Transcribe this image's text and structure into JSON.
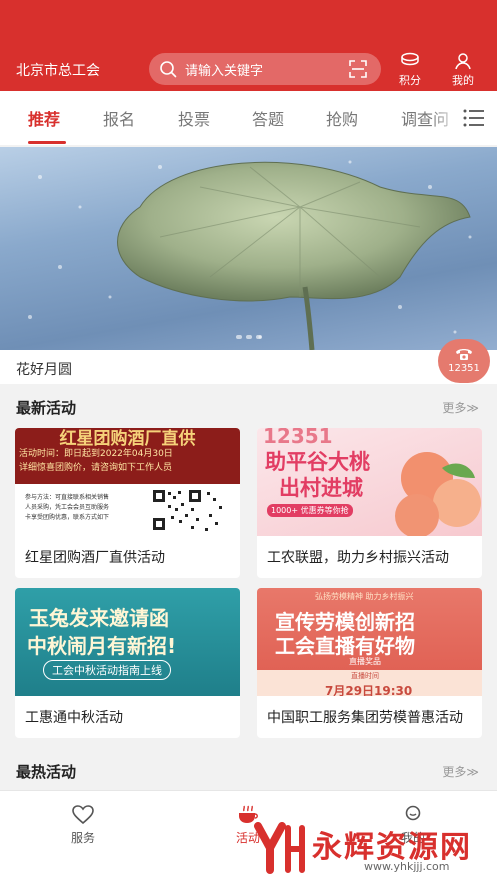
{
  "header": {
    "org_name": "北京市总工会",
    "search_placeholder": "请输入关键字",
    "points_label": "积分",
    "mine_label": "我的"
  },
  "tabs": [
    {
      "label": "推荐",
      "active": true
    },
    {
      "label": "报名"
    },
    {
      "label": "投票"
    },
    {
      "label": "答题"
    },
    {
      "label": "抢购"
    },
    {
      "label": "调查问"
    }
  ],
  "banner": {
    "caption": "花好月圆"
  },
  "hotline": {
    "number": "12351"
  },
  "latest": {
    "title": "最新活动",
    "more": "更多≫",
    "cards": [
      {
        "title": "红星团购酒厂直供活动",
        "img_lines": [
          "红星团购酒厂直供",
          "活动时间：即日起到2022年04月30日",
          "详细惊喜团购价，请咨询如下工作人员",
          "参与方法：可直接联系相关销售",
          "人员采购，凭工会会员互助服务",
          "卡享受团购优惠，联系方式如下"
        ]
      },
      {
        "title": "工农联盟，助力乡村振兴活动",
        "img_lines": [
          "12351",
          "助平谷大桃",
          "出村进城",
          "1000+ 优惠券等你抢"
        ]
      },
      {
        "title": "工惠通中秋活动",
        "img_lines": [
          "玉兔发来邀请函",
          "中秋闹月有新招!",
          "工会中秋活动指南上线"
        ]
      },
      {
        "title": "中国职工服务集团劳模普惠活动",
        "img_lines": [
          "弘扬劳模精神 助力乡村振兴",
          "宣传劳模创新招",
          "工会直播有好物",
          "直播奖品",
          "直播时间",
          "7月29日19:30"
        ]
      }
    ]
  },
  "hottest": {
    "title": "最热活动",
    "more": "更多≫"
  },
  "bottom_nav": [
    {
      "label": "服务",
      "icon": "heart-icon"
    },
    {
      "label": "活动",
      "icon": "cup-icon",
      "active": true
    },
    {
      "label": "我的",
      "icon": "user-icon"
    }
  ],
  "watermark": {
    "title": "永辉资源网",
    "url": "www.yhkjjj.com"
  },
  "colors": {
    "brand_red": "#d8302d"
  }
}
